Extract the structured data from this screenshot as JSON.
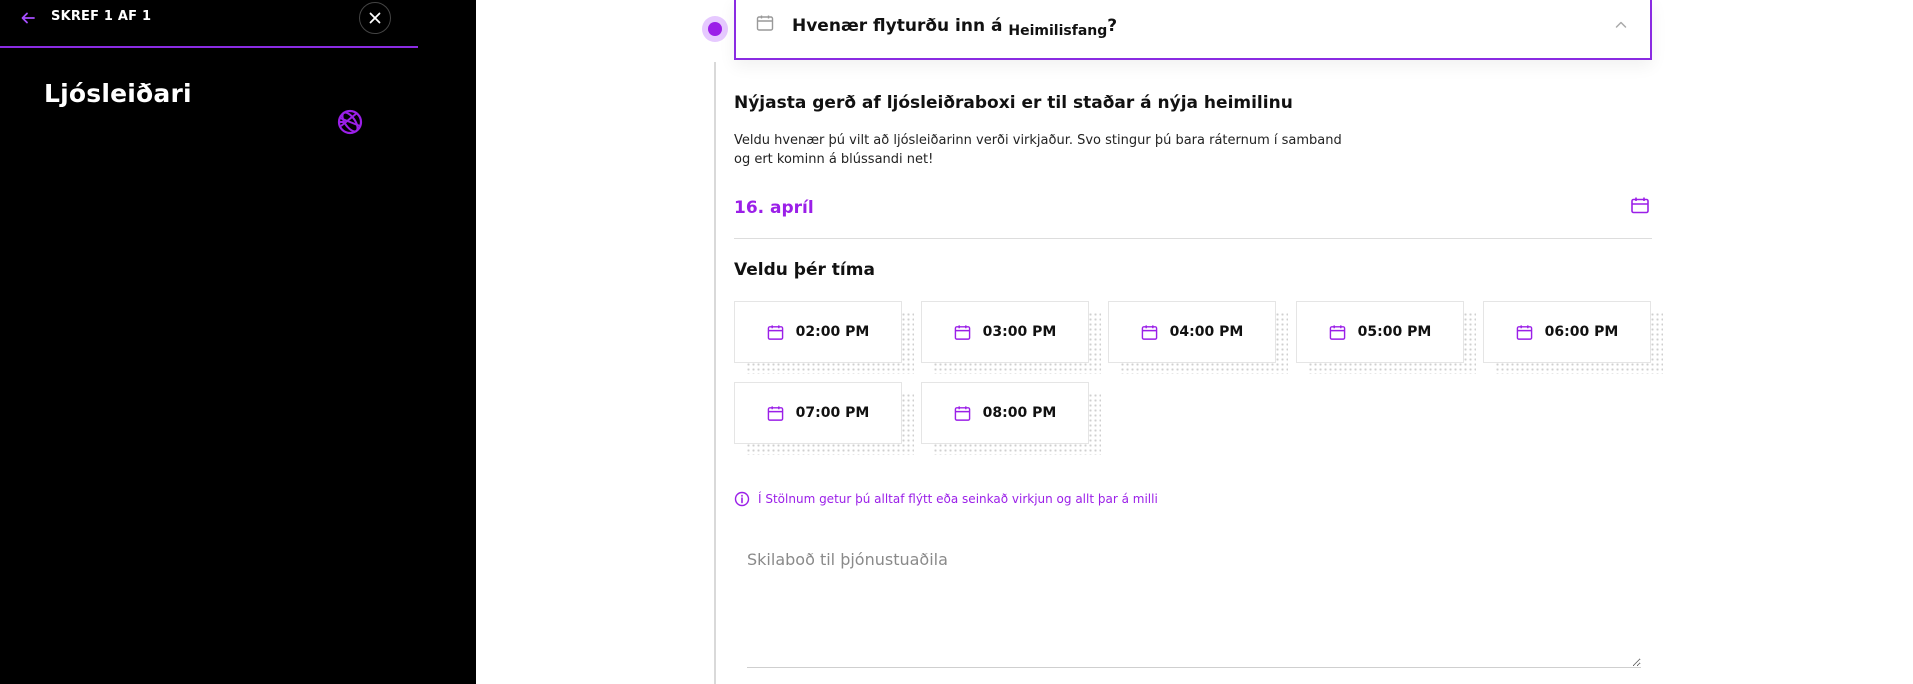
{
  "sidebar": {
    "step_label": "SKREF 1 AF 1",
    "title": "Ljósleiðari"
  },
  "accordion": {
    "title": "Hvenær flyturðu inn á",
    "subject": "Heimilisfang",
    "suffix": "?"
  },
  "content": {
    "heading": "Nýjasta gerð af ljósleiðraboxi er til staðar á nýja heimilinu",
    "description": "Veldu hvenær þú vilt að ljósleiðarinn verði virkjaður. Svo stingur þú bara ráternum í samband og ert kominn á blússandi net!"
  },
  "date": {
    "value": "16. apríl"
  },
  "time": {
    "heading": "Veldu þér tíma",
    "slots": [
      "02:00 PM",
      "03:00 PM",
      "04:00 PM",
      "05:00 PM",
      "06:00 PM",
      "07:00 PM",
      "08:00 PM"
    ]
  },
  "info": {
    "text": "Í Stölnum getur þú alltaf flýtt eða seinkað virkjun og allt þar á milli"
  },
  "message": {
    "placeholder": "Skilaboð til þjónustuaðila"
  },
  "colors": {
    "accent": "#9b1fe8",
    "sidebar_bg": "#000000"
  }
}
